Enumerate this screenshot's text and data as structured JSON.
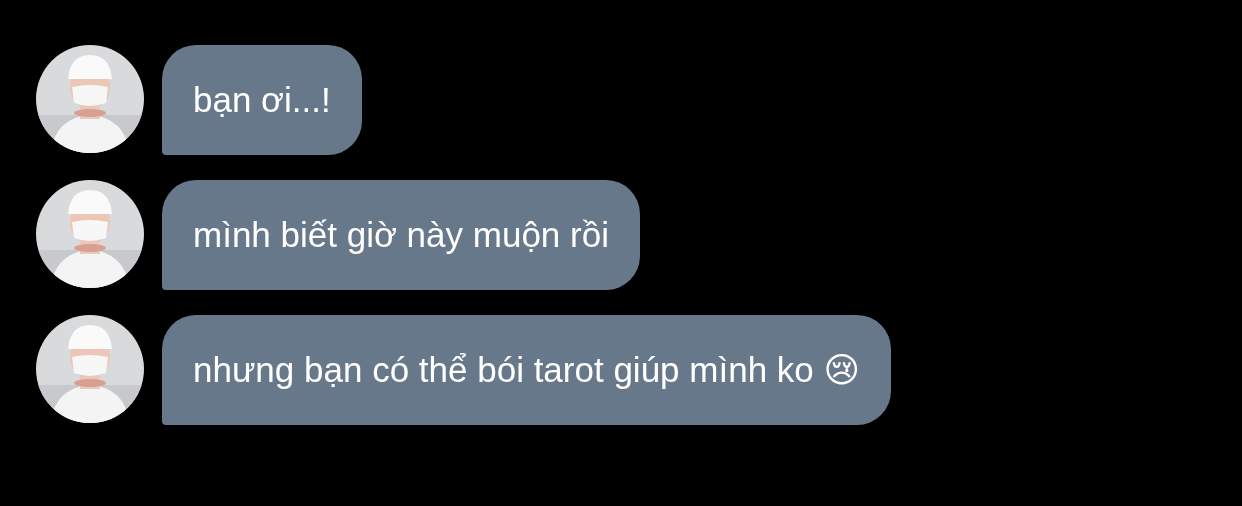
{
  "messages": [
    {
      "text": "bạn ơi...!"
    },
    {
      "text": "mình biết giờ này muộn rồi"
    },
    {
      "text": "nhưng bạn có thể bói tarot giúp mình ko 😢"
    }
  ]
}
